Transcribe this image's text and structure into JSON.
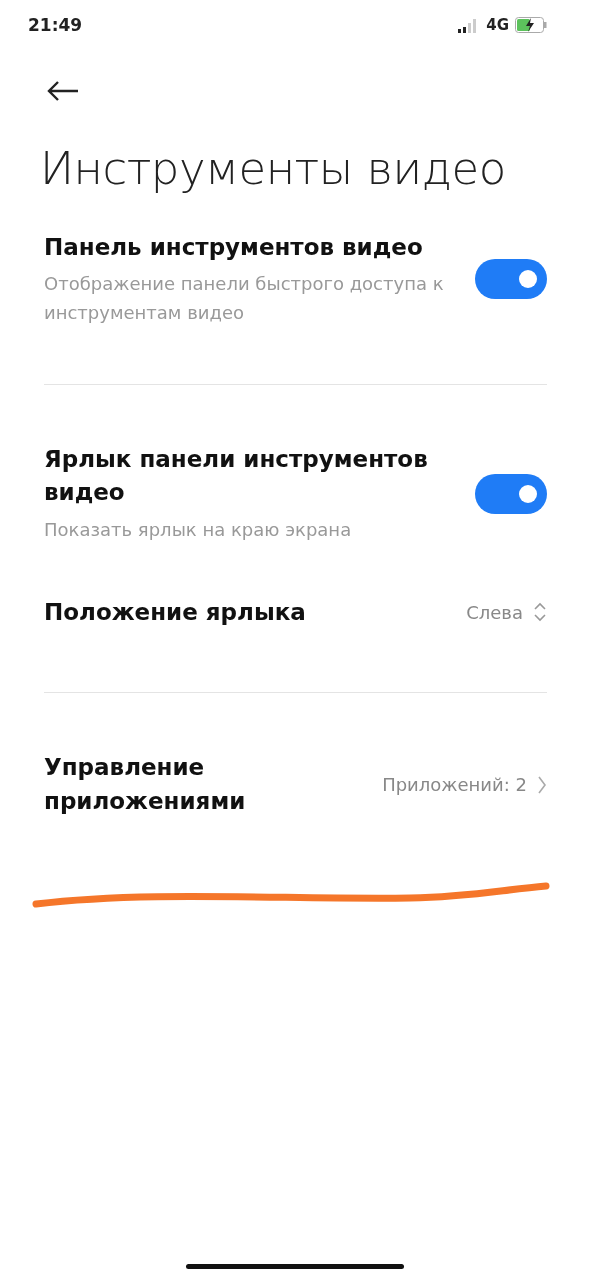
{
  "status_bar": {
    "time": "21:49",
    "network": "4G"
  },
  "title": "Инструменты видео",
  "sections": [
    {
      "items": [
        {
          "kind": "toggle",
          "title": "Панель инструментов видео",
          "subtitle": "Отображение панели быстрого доступа к инструментам видео",
          "on": true
        }
      ]
    },
    {
      "items": [
        {
          "kind": "toggle",
          "title": "Ярлык панели инструментов видео",
          "subtitle": "Показать ярлык на краю экрана",
          "on": true
        },
        {
          "kind": "select",
          "title": "Положение ярлыка",
          "value": "Слева"
        }
      ]
    },
    {
      "items": [
        {
          "kind": "link",
          "title": "Управление приложениями",
          "value": "Приложений: 2"
        }
      ]
    }
  ]
}
